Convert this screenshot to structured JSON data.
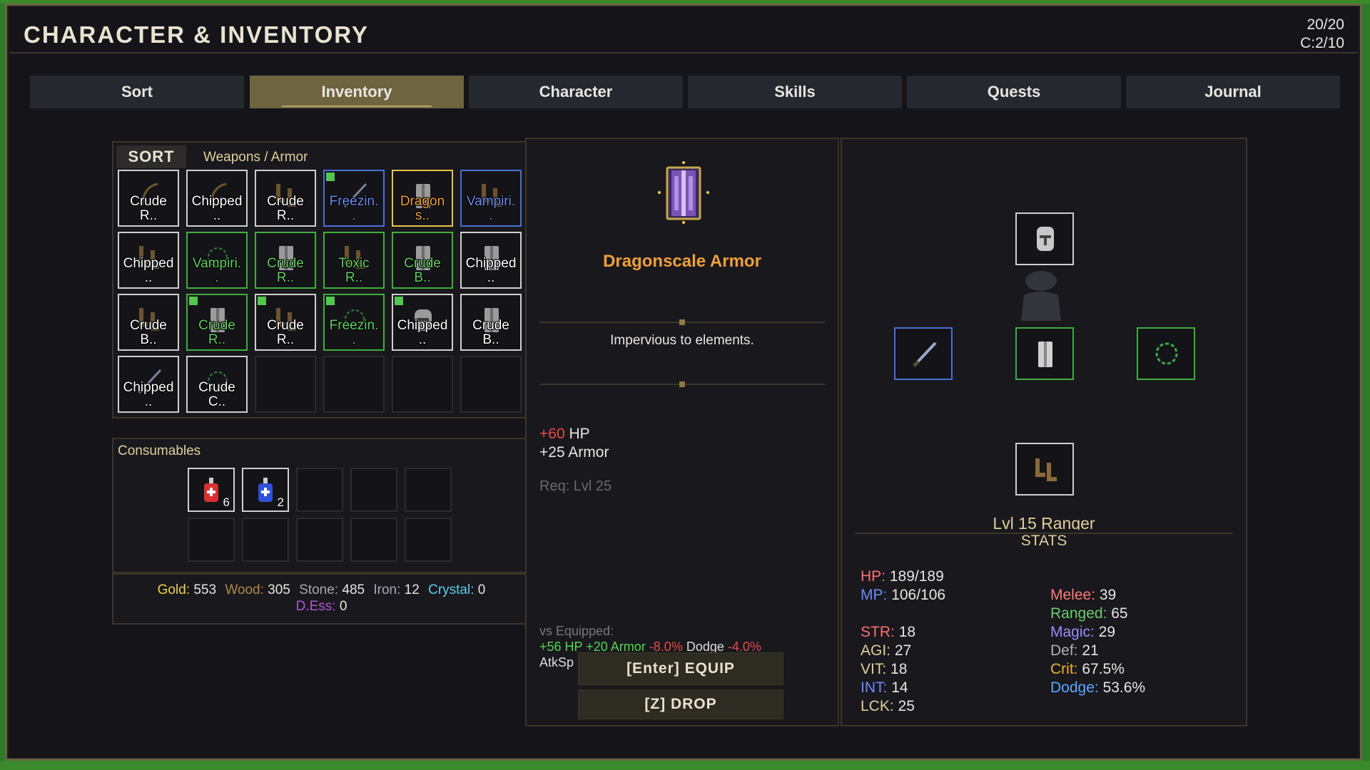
{
  "window": {
    "title": "CHARACTER & INVENTORY",
    "slot_count": "20/20",
    "consumable_count": "C:2/10"
  },
  "tabs": [
    {
      "label": "Sort",
      "active": false
    },
    {
      "label": "Inventory",
      "active": true
    },
    {
      "label": "Character",
      "active": false
    },
    {
      "label": "Skills",
      "active": false
    },
    {
      "label": "Quests",
      "active": false
    },
    {
      "label": "Journal",
      "active": false
    }
  ],
  "inventory": {
    "sort_label": "SORT",
    "filter_label": "Weapons / Armor",
    "slots": [
      {
        "name": "Crude\nR..",
        "rarity": "common",
        "icon": "bow-icon",
        "marked": false
      },
      {
        "name": "Chipped\n..",
        "rarity": "common",
        "icon": "bow-icon",
        "marked": false
      },
      {
        "name": "Crude\nR..",
        "rarity": "common",
        "icon": "boots-icon",
        "marked": false
      },
      {
        "name": "Freezin.\n.",
        "rarity": "rare",
        "icon": "sword-icon",
        "marked": true
      },
      {
        "name": "Dragon\ns..",
        "rarity": "legendary",
        "icon": "armor-icon",
        "marked": false
      },
      {
        "name": "Vampiri.\n.",
        "rarity": "rare",
        "icon": "boots-icon",
        "marked": false
      },
      {
        "name": "Chipped\n..",
        "rarity": "common",
        "icon": "boots-icon",
        "marked": false
      },
      {
        "name": "Vampiri.\n.",
        "rarity": "uncommon",
        "icon": "ring-icon",
        "marked": false
      },
      {
        "name": "Crude\nR..",
        "rarity": "uncommon",
        "icon": "armor-icon",
        "marked": false
      },
      {
        "name": "Toxic\nR..",
        "rarity": "uncommon",
        "icon": "boots-icon",
        "marked": false
      },
      {
        "name": "Crude\nB..",
        "rarity": "uncommon",
        "icon": "armor-icon",
        "marked": false
      },
      {
        "name": "Chipped\n..",
        "rarity": "common",
        "icon": "armor-icon",
        "marked": false
      },
      {
        "name": "Crude\nB..",
        "rarity": "common",
        "icon": "boots-icon",
        "marked": false
      },
      {
        "name": "Crude\nR..",
        "rarity": "uncommon",
        "icon": "armor-icon",
        "marked": true
      },
      {
        "name": "Crude\nR..",
        "rarity": "common",
        "icon": "boots-icon",
        "marked": true
      },
      {
        "name": "Freezin.\n.",
        "rarity": "uncommon",
        "icon": "ring-icon",
        "marked": true
      },
      {
        "name": "Chipped\n..",
        "rarity": "common",
        "icon": "helmet-icon",
        "marked": true
      },
      {
        "name": "Crude\nB..",
        "rarity": "common",
        "icon": "armor-icon",
        "marked": false
      },
      {
        "name": "Chipped\n..",
        "rarity": "common",
        "icon": "sword-icon",
        "marked": false
      },
      {
        "name": "Crude\nC..",
        "rarity": "common",
        "icon": "ring-icon",
        "marked": false
      },
      {
        "name": "",
        "rarity": "empty",
        "icon": "",
        "marked": false
      },
      {
        "name": "",
        "rarity": "empty",
        "icon": "",
        "marked": false
      },
      {
        "name": "",
        "rarity": "empty",
        "icon": "",
        "marked": false
      },
      {
        "name": "",
        "rarity": "empty",
        "icon": "",
        "marked": false
      }
    ]
  },
  "consumables": {
    "label": "Consumables",
    "slots": [
      {
        "icon": "health-potion-icon",
        "count": "6"
      },
      {
        "icon": "mana-potion-icon",
        "count": "2"
      },
      {
        "icon": "",
        "count": ""
      },
      {
        "icon": "",
        "count": ""
      },
      {
        "icon": "",
        "count": ""
      },
      {
        "icon": "",
        "count": ""
      },
      {
        "icon": "",
        "count": ""
      },
      {
        "icon": "",
        "count": ""
      },
      {
        "icon": "",
        "count": ""
      },
      {
        "icon": "",
        "count": ""
      }
    ]
  },
  "resources": {
    "gold_label": "Gold:",
    "gold": "553",
    "wood_label": "Wood:",
    "wood": "305",
    "stone_label": "Stone:",
    "stone": "485",
    "iron_label": "Iron:",
    "iron": "12",
    "crystal_label": "Crystal:",
    "crystal": "0",
    "dess_label": "D.Ess:",
    "dess": "0",
    "colors": {
      "gold": "#f0d04a",
      "wood": "#b08a4a",
      "stone": "#a8a8a8",
      "iron": "#a8a8b8",
      "crystal": "#5ad0e8",
      "dess": "#b058d8"
    }
  },
  "detail": {
    "icon": "dragonscale-armor-icon",
    "name": "Dragonscale Armor",
    "description": "Impervious to elements.",
    "bonus_hp_value": "+60",
    "bonus_hp_label": "HP",
    "bonus_armor": "+25 Armor",
    "requirement": "Req: Lvl 25",
    "vs_label": "vs Equipped:",
    "vs_hp": "+56 HP",
    "vs_armor": "+20 Armor",
    "vs_crit": "-8.0%",
    "vs_dodge_label": "Dodge",
    "vs_dodge": "-4.0%",
    "vs_atkspd": "AtkSp",
    "equip_button": "[Enter] EQUIP",
    "drop_button": "[Z] DROP",
    "name_color": "#f0a03a",
    "positive_color": "#50d850",
    "negative_color": "#e84a4a"
  },
  "character": {
    "slots": {
      "head": {
        "icon": "helmet-icon"
      },
      "weapon": {
        "icon": "sword-icon"
      },
      "body": {
        "icon": "armor-icon"
      },
      "accessory": {
        "icon": "ring-icon"
      },
      "feet": {
        "icon": "boots-icon"
      }
    },
    "class_label": "Lvl 15 Ranger",
    "stats_title": "STATS",
    "hp_label": "HP:",
    "hp": "189/189",
    "mp_label": "MP:",
    "mp": "106/106",
    "str_label": "STR:",
    "str": "18",
    "agi_label": "AGI:",
    "agi": "27",
    "vit_label": "VIT:",
    "vit": "18",
    "int_label": "INT:",
    "int": "14",
    "lck_label": "LCK:",
    "lck": "25",
    "melee_label": "Melee:",
    "melee": "39",
    "ranged_label": "Ranged:",
    "ranged": "65",
    "magic_label": "Magic:",
    "magic": "29",
    "def_label": "Def:",
    "def": "21",
    "crit_label": "Crit:",
    "crit": "67.5%",
    "dodge_label": "Dodge:",
    "dodge": "53.6%",
    "colors": {
      "hp": "#ff7070",
      "mp": "#6a8cff",
      "str": "#ff7070",
      "agi": "#e0cf9a",
      "vit": "#e0cf9a",
      "int": "#6a8cff",
      "lck": "#e0cf9a",
      "melee": "#ff7a7a",
      "ranged": "#6ad06a",
      "magic": "#9b8cff",
      "def": "#b0b0b0",
      "crit": "#f0b030",
      "dodge": "#5aa8ff"
    }
  }
}
